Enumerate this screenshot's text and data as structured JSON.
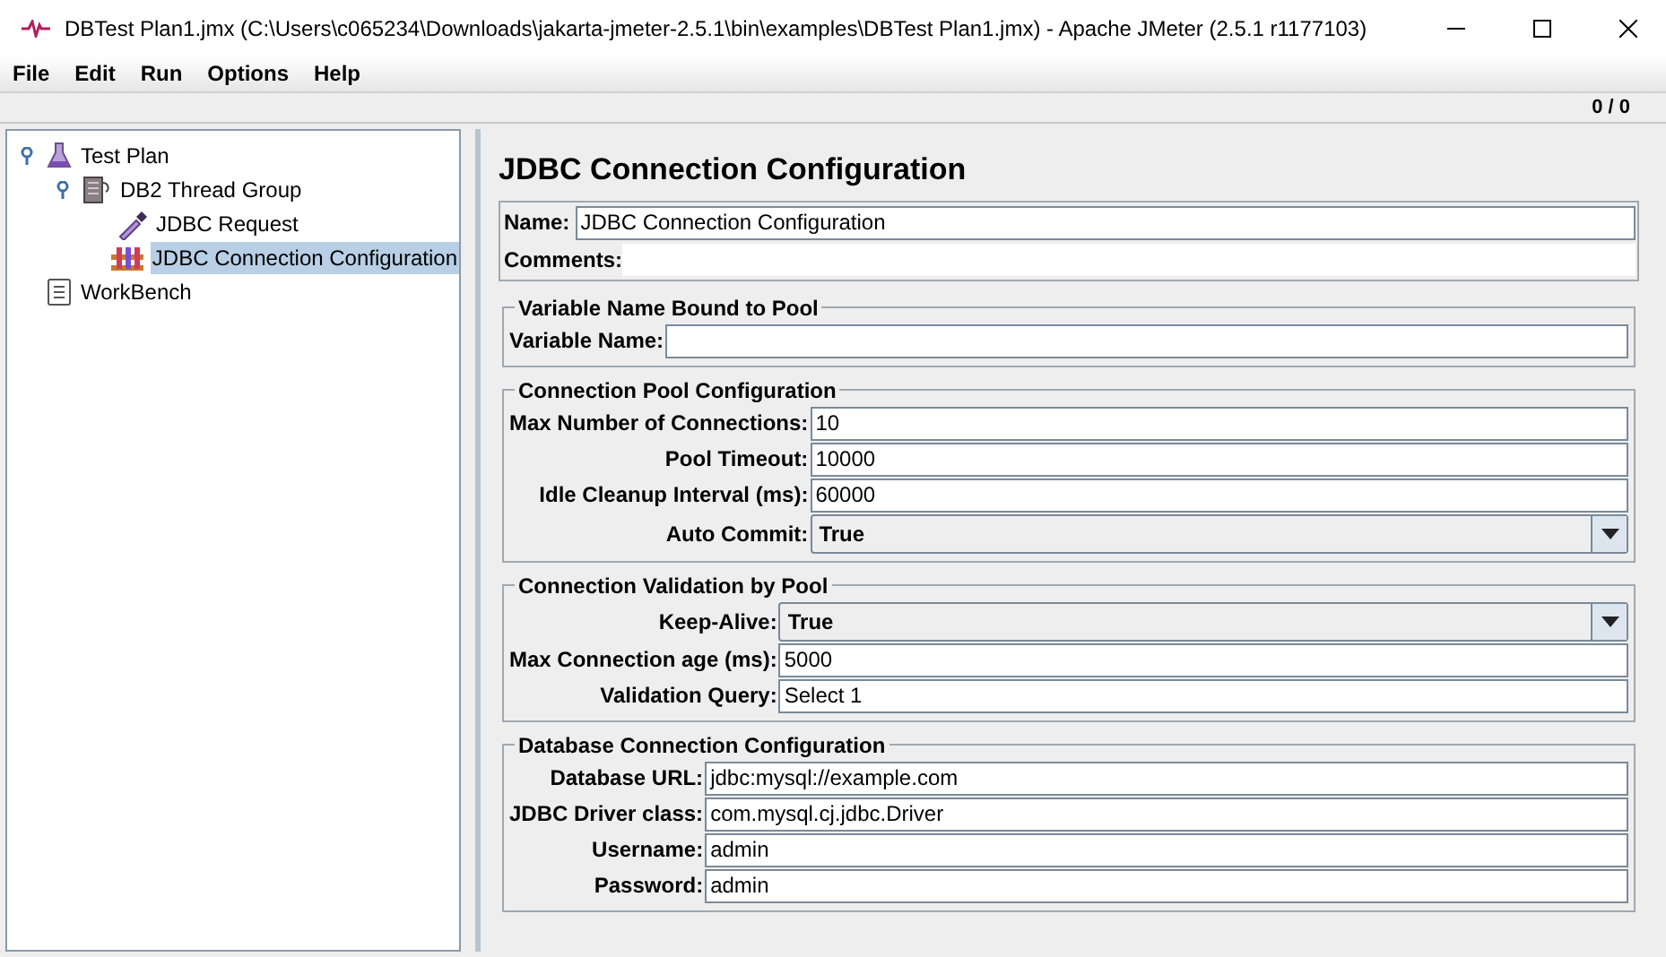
{
  "window": {
    "title": "DBTest Plan1.jmx (C:\\Users\\c065234\\Downloads\\jakarta-jmeter-2.5.1\\bin\\examples\\DBTest Plan1.jmx) - Apache JMeter (2.5.1 r1177103)"
  },
  "menu": [
    "File",
    "Edit",
    "Run",
    "Options",
    "Help"
  ],
  "toolbar": {
    "counter": "0 / 0"
  },
  "tree": [
    {
      "label": "Test Plan",
      "kind": "plan",
      "selected": false,
      "children": [
        {
          "label": "DB2 Thread Group",
          "kind": "threads",
          "selected": false,
          "children": [
            {
              "label": "JDBC Request",
              "kind": "sampler",
              "selected": false
            },
            {
              "label": "JDBC Connection Configuration",
              "kind": "config",
              "selected": true
            }
          ]
        }
      ]
    },
    {
      "label": "WorkBench",
      "kind": "workbench",
      "selected": false
    }
  ],
  "panel": {
    "title": "JDBC Connection Configuration",
    "name": {
      "label": "Name:",
      "value": "JDBC Connection Configuration"
    },
    "comments": {
      "label": "Comments:"
    },
    "sections": [
      {
        "legend": "Variable Name Bound to Pool",
        "fields": [
          {
            "label": "Variable Name:",
            "kind": "text"
          }
        ]
      },
      {
        "legend": "Connection Pool Configuration",
        "fields": [
          {
            "label": "Max Number of Connections:",
            "kind": "text",
            "value": "10"
          },
          {
            "label": "Pool Timeout:",
            "kind": "text",
            "value": "10000"
          },
          {
            "label": "Idle Cleanup Interval (ms):",
            "kind": "text",
            "value": "60000"
          },
          {
            "label": "Auto Commit:",
            "kind": "combo",
            "value": "True"
          }
        ]
      },
      {
        "legend": "Connection Validation by Pool",
        "fields": [
          {
            "label": "Keep-Alive:",
            "kind": "combo",
            "value": "True"
          },
          {
            "label": "Max Connection age (ms):",
            "kind": "text",
            "value": "5000"
          },
          {
            "label": "Validation Query:",
            "kind": "text",
            "value": "Select 1"
          }
        ]
      },
      {
        "legend": "Database Connection Configuration",
        "fields": [
          {
            "label": "Database URL:",
            "kind": "text",
            "value": "jdbc:mysql://example.com"
          },
          {
            "label": "JDBC Driver class:",
            "kind": "text",
            "value": "com.mysql.cj.jdbc.Driver"
          },
          {
            "label": "Username:",
            "kind": "text",
            "value": "admin"
          },
          {
            "label": "Password:",
            "kind": "text",
            "value": "admin"
          }
        ]
      }
    ]
  }
}
